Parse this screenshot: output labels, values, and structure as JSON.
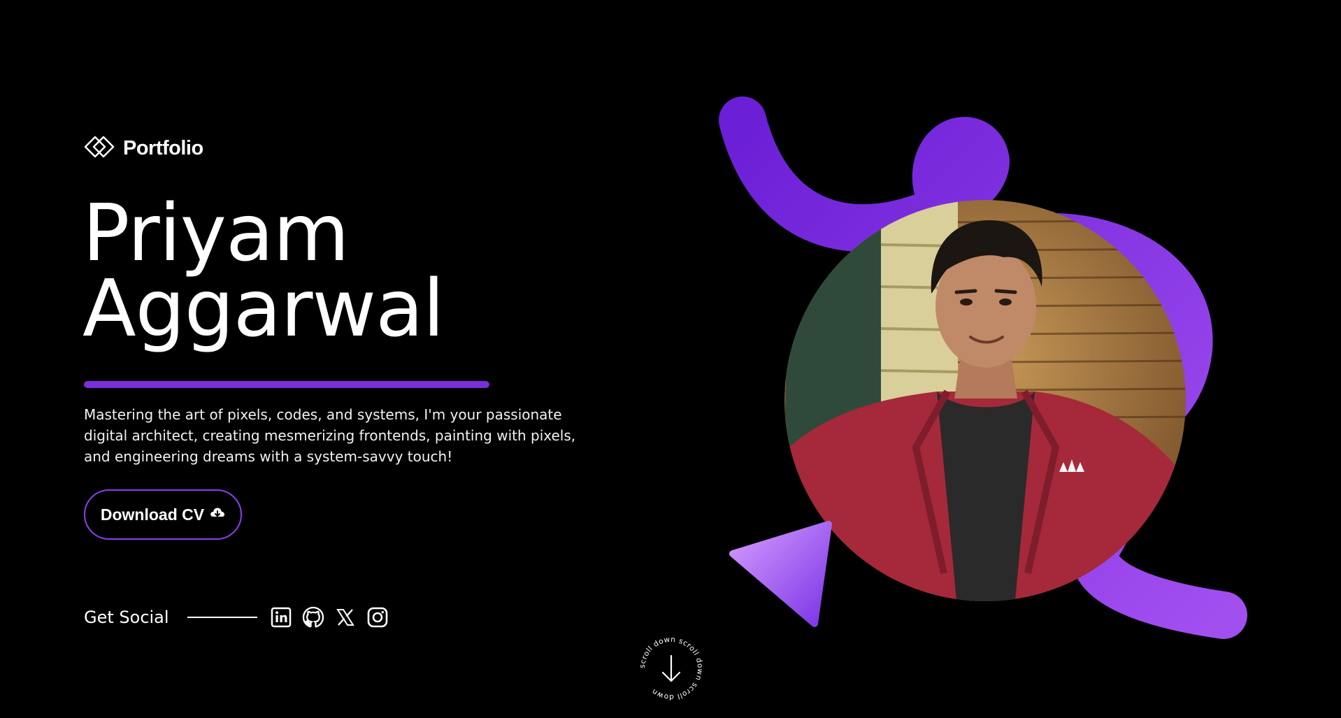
{
  "logo": {
    "text": "Portfolio",
    "icon": "diamond-logo-icon"
  },
  "hero": {
    "first_name": "Priyam",
    "last_name": "Aggarwal",
    "tagline": "Mastering the art of pixels, codes, and systems, I'm your passionate digital architect, creating mesmerizing frontends, painting with pixels, and engineering dreams with a system-savvy touch!",
    "cv_button_label": "Download CV",
    "cv_button_icon": "cloud-download-icon",
    "profile_photo": "profile-photo"
  },
  "social": {
    "label": "Get Social",
    "icons": [
      "linkedin-icon",
      "github-icon",
      "x-icon",
      "instagram-icon"
    ]
  },
  "scroll": {
    "text": "scroll down scroll down scroll down ",
    "icon": "arrow-down-icon"
  },
  "colors": {
    "background": "#000000",
    "accent": "#7a2fd9",
    "accent_light": "#9b4de8",
    "text": "#ffffff"
  }
}
